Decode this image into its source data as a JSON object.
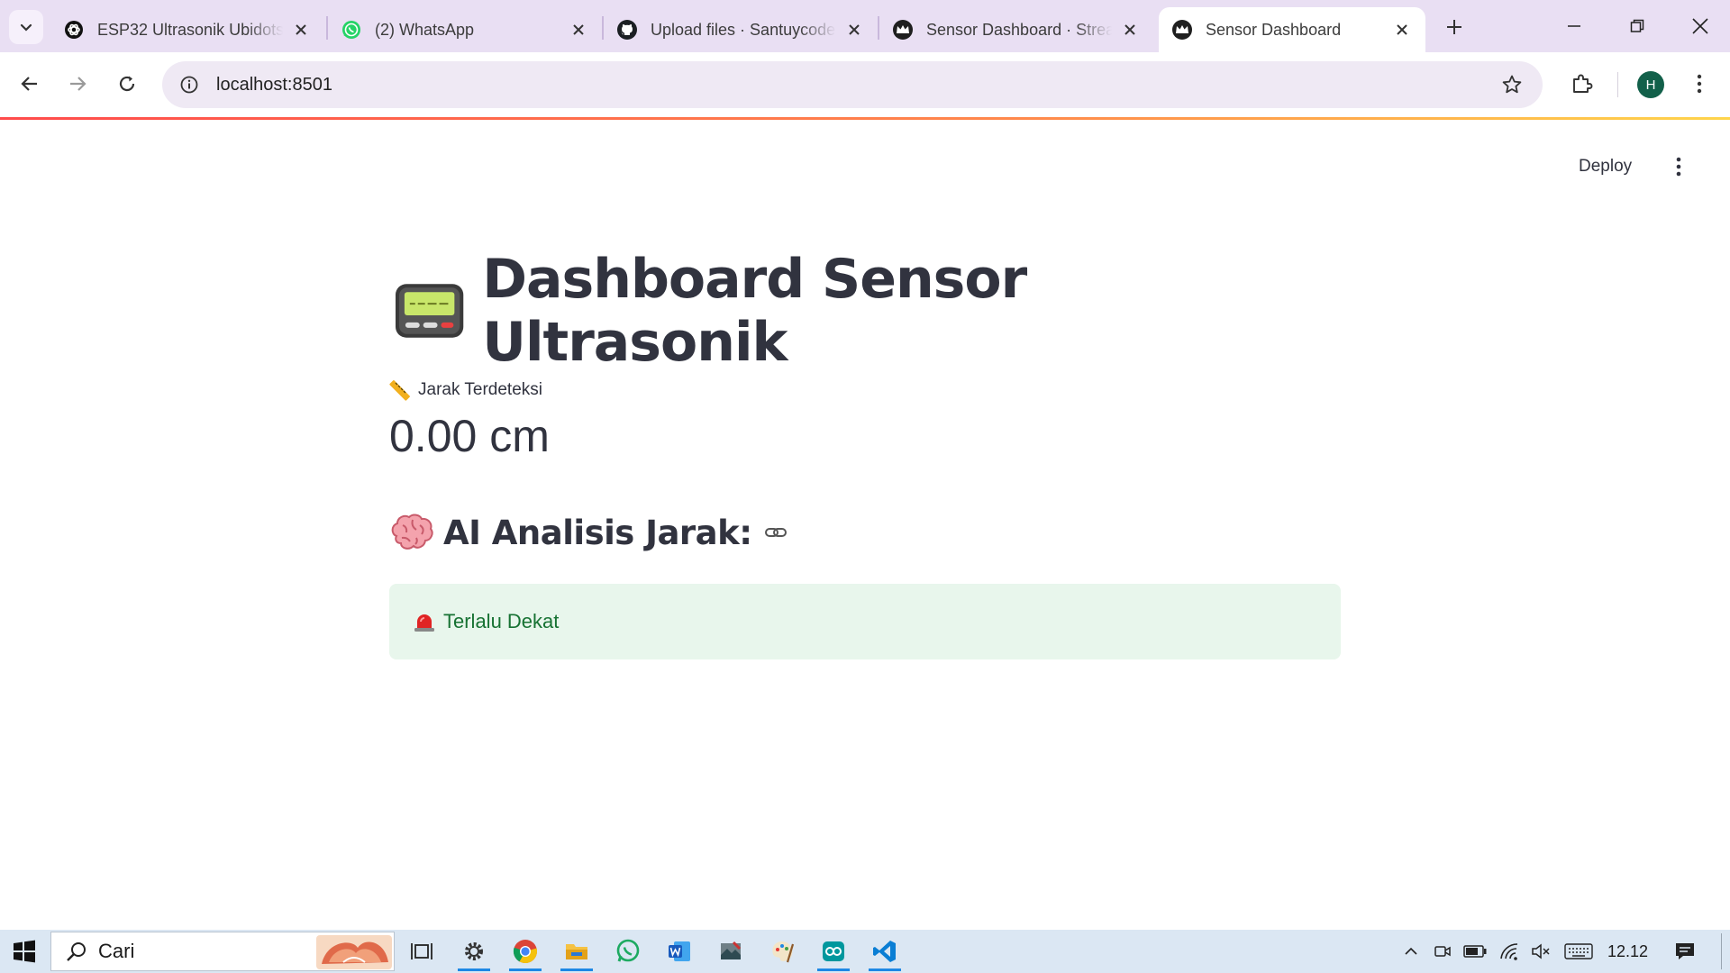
{
  "browser": {
    "tabs": [
      {
        "title": "ESP32 Ultrasonik Ubidots",
        "favicon": "openai-icon",
        "active": false
      },
      {
        "title": "(2) WhatsApp",
        "favicon": "whatsapp-icon",
        "active": false
      },
      {
        "title": "Upload files · Santuycode",
        "favicon": "github-icon",
        "active": false
      },
      {
        "title": "Sensor Dashboard · Streamlit",
        "favicon": "streamlit-crown-icon",
        "active": false
      },
      {
        "title": "Sensor Dashboard",
        "favicon": "streamlit-crown-icon",
        "active": true
      }
    ],
    "url": "localhost:8501",
    "profile_initial": "H",
    "accent_colors": {
      "tabstrip": "#e9dff3",
      "omnibox": "#efe9f4",
      "profile": "#12604a"
    }
  },
  "app": {
    "deploy_label": "Deploy",
    "title": "Dashboard Sensor Ultrasonik",
    "title_emoji": "pager-icon",
    "metric": {
      "label": "Jarak Terdeteksi",
      "label_emoji": "ruler-icon",
      "value": "0.00 cm"
    },
    "analysis": {
      "heading": "AI Analisis Jarak:",
      "heading_emoji": "brain-icon",
      "result": "Terlalu Dekat",
      "result_emoji": "siren-icon",
      "colors": {
        "background": "#e8f6ec",
        "text": "#177233"
      }
    }
  },
  "taskbar": {
    "search_placeholder": "Cari",
    "pinned": [
      "task-view-icon",
      "settings-icon",
      "chrome-icon",
      "file-explorer-icon",
      "whatsapp-icon",
      "word-icon",
      "app-icon",
      "paint-icon",
      "arduino-icon",
      "vscode-icon"
    ],
    "clock": "12.12"
  }
}
